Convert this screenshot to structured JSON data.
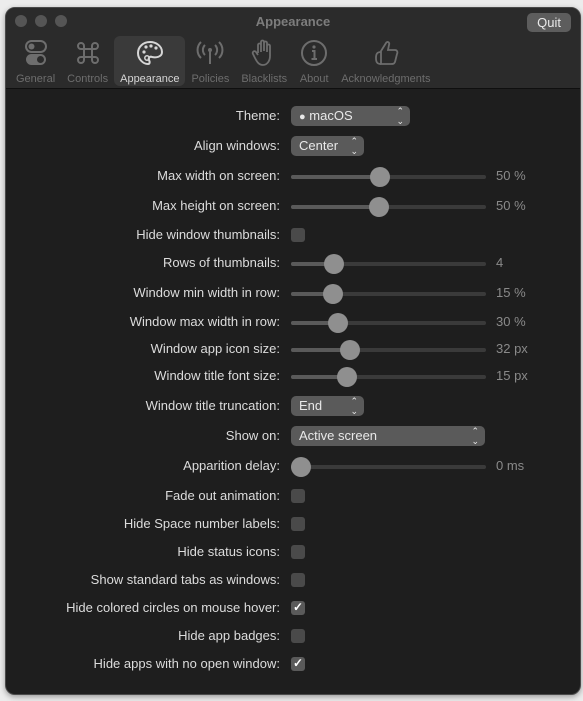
{
  "window": {
    "title": "Appearance",
    "quit_label": "Quit"
  },
  "tabs": [
    {
      "label": "General",
      "icon": "toggle-switches-icon",
      "active": false
    },
    {
      "label": "Controls",
      "icon": "command-key-icon",
      "active": false
    },
    {
      "label": "Appearance",
      "icon": "palette-icon",
      "active": true
    },
    {
      "label": "Policies",
      "icon": "antenna-icon",
      "active": false
    },
    {
      "label": "Blacklists",
      "icon": "raised-hand-icon",
      "active": false
    },
    {
      "label": "About",
      "icon": "info-circle-icon",
      "active": false
    },
    {
      "label": "Acknowledgments",
      "icon": "thumbs-up-icon",
      "active": false
    }
  ],
  "settings": {
    "theme": {
      "label": "Theme:",
      "value": "macOS",
      "icon": "apple-logo-icon"
    },
    "align_windows": {
      "label": "Align windows:",
      "value": "Center"
    },
    "max_width": {
      "label": "Max width on screen:",
      "value": "50 %",
      "fraction": 0.45
    },
    "max_height": {
      "label": "Max height on screen:",
      "value": "50 %",
      "fraction": 0.445
    },
    "hide_thumbnails": {
      "label": "Hide window thumbnails:",
      "checked": false
    },
    "rows": {
      "label": "Rows of thumbnails:",
      "value": "4",
      "fraction": 0.19
    },
    "min_width_row": {
      "label": "Window min width in row:",
      "value": "15 %",
      "fraction": 0.18
    },
    "max_width_row": {
      "label": "Window max width in row:",
      "value": "30 %",
      "fraction": 0.21
    },
    "icon_size": {
      "label": "Window app icon size:",
      "value": "32 px",
      "fraction": 0.28
    },
    "title_font_size": {
      "label": "Window title font size:",
      "value": "15 px",
      "fraction": 0.265
    },
    "title_truncation": {
      "label": "Window title truncation:",
      "value": "End"
    },
    "show_on": {
      "label": "Show on:",
      "value": "Active screen"
    },
    "apparition_delay": {
      "label": "Apparition delay:",
      "value": "0 ms",
      "fraction": 0.0
    },
    "fade_out": {
      "label": "Fade out animation:",
      "checked": false
    },
    "hide_space_labels": {
      "label": "Hide Space number labels:",
      "checked": false
    },
    "hide_status_icons": {
      "label": "Hide status icons:",
      "checked": false
    },
    "standard_tabs": {
      "label": "Show standard tabs as windows:",
      "checked": false
    },
    "hide_colored_circles": {
      "label": "Hide colored circles on mouse hover:",
      "checked": true
    },
    "hide_badges": {
      "label": "Hide app badges:",
      "checked": false
    },
    "hide_no_window_apps": {
      "label": "Hide apps with no open window:",
      "checked": true
    }
  }
}
